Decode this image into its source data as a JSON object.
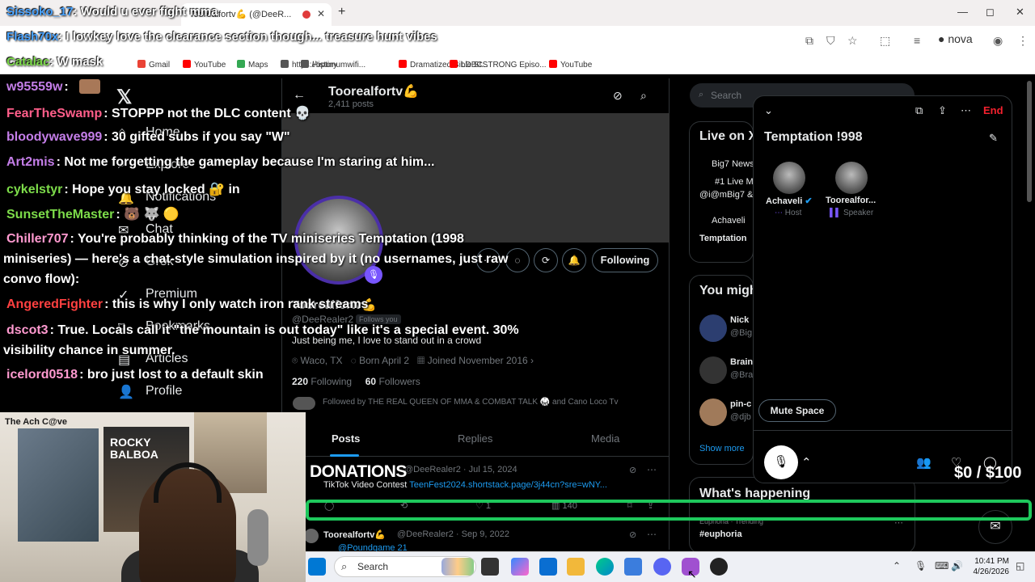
{
  "browser": {
    "tab_title": "Toorealfortv💪 (@DeeR...",
    "new_tab_icon": "+",
    "window_controls": [
      "—",
      "◻",
      "✕"
    ],
    "address_icons": [
      "screen-cast-icon",
      "shield-icon",
      "star-icon",
      "extensions-icon",
      "reading-list-icon"
    ],
    "profile_label": "nova",
    "bookmarks": [
      {
        "label": "Gmail",
        "color": "#ea4335"
      },
      {
        "label": "YouTube",
        "color": "#ff0000"
      },
      {
        "label": "Maps",
        "color": "#34a853"
      },
      {
        "label": "https://optimumwifi...",
        "color": "#555555"
      },
      {
        "label": "History",
        "color": "#555555"
      },
      {
        "label": "Dramatized Bible St...",
        "color": "#ff0000"
      },
      {
        "label": "LDBCSTRONG Episo...",
        "color": "#ff0000"
      },
      {
        "label": "YouTube",
        "color": "#ff0000"
      }
    ]
  },
  "x_nav": {
    "items": [
      "Home",
      "Explore",
      "Notifications",
      "Chat",
      "Grok",
      "Premium",
      "Bookmarks",
      "Articles",
      "Profile"
    ]
  },
  "profile": {
    "display_name": "Toorealfortv💪",
    "posts_count": "2,411 posts",
    "handle": "@DeeRealer2",
    "follows_you": "Follows you",
    "bio": "Just being me, I love to stand out in a crowd",
    "location": "Waco, TX",
    "born": "Born April 2",
    "joined": "Joined November 2016",
    "following_count": "220",
    "following_label": "Following",
    "followers_count": "60",
    "followers_label": "Followers",
    "followed_by": "Followed by THE REAL QUEEN OF MMA & COMBAT TALK 🥋 and Cano Loco Tv",
    "following_button": "Following",
    "tabs": [
      "Posts",
      "Replies",
      "Media"
    ]
  },
  "tweets": [
    {
      "author": "Toorealfortv💪",
      "handle": "@DeeRealer2",
      "date": "Jul 15, 2024",
      "text": "TikTok Video Contest",
      "link": "TeenFest2024.shortstack.page/3j44cn?sre=wNY...",
      "replies": "",
      "retweets": "",
      "likes": "1",
      "views": "140"
    },
    {
      "author": "Toorealfortv💪",
      "handle": "@DeeRealer2",
      "date": "Sep 9, 2022",
      "text": "",
      "link": "@Poundgame 21"
    }
  ],
  "right_column": {
    "search_placeholder": "Search",
    "live_title": "Live on X",
    "live_items": [
      "Big7 News",
      "#1 Live M",
      "@i@mBig7 &",
      "Achaveli",
      "Temptation"
    ],
    "you_might": "You might",
    "suggestions": [
      {
        "name": "Nick",
        "handle": "@Big"
      },
      {
        "name": "Brain",
        "handle": "@Bra"
      },
      {
        "name": "pin-c",
        "handle": "@djb"
      }
    ],
    "show_more": "Show more",
    "whats_happening": "What's happening",
    "trend_category": "Euphoria · Trending",
    "trend_name": "#euphoria"
  },
  "space": {
    "title": "Temptation !998",
    "end_label": "End",
    "host_name": "Achaveli",
    "host_role": "Host",
    "speaker_name": "Tooreal​for...",
    "speaker_role": "Speaker",
    "mute_label": "Mute Space"
  },
  "stream_overlay": {
    "top_messages": [
      {
        "user": "Sissoko_17",
        "user_color": "#4aa3ff",
        "text": ": Would u ever fight mma"
      },
      {
        "user": "Flash70x",
        "user_color": "#4aa3ff",
        "text": ": I lowkey love the clearance section though... treasure hunt vibes"
      },
      {
        "user": "Catalac",
        "user_color": "#7ddc4a",
        "text": ": W mask"
      }
    ],
    "chat": [
      {
        "user": "w95559w",
        "user_color": "#c47ee8",
        "text": ":"
      },
      {
        "user": "FearTheSwamp",
        "user_color": "#ff5e8a",
        "text": ": STOPPP not the DLC content 💀"
      },
      {
        "user": "bloodywave999",
        "user_color": "#c47ee8",
        "text": ": 30 gifted subs if you say \"W\""
      },
      {
        "user": "Art2mis",
        "user_color": "#c47ee8",
        "text": ": Not me forgetting the gameplay because I'm staring at him..."
      },
      {
        "user": "cykelstyr",
        "user_color": "#7ddc4a",
        "text": ": Hope you stay locked 🔐 in"
      },
      {
        "user": "SunsetTheMaster",
        "user_color": "#7ddc4a",
        "text": ": 🐻 🐺 🟡"
      },
      {
        "user": "Chiller707",
        "user_color": "#ff9ad0",
        "text": ": You're probably thinking of the TV miniseries Temptation (1998"
      },
      {
        "user": "AngeredFighter",
        "user_color": "#ff4040",
        "text": ": this is why I only watch iron rank streams"
      },
      {
        "user": "dscot3",
        "user_color": "#ff9ad0",
        "text": ": True. Locals call it \"the mountain is out today\" like it's a special event. 30%"
      },
      {
        "user": "icelord0518",
        "user_color": "#ff9ad0",
        "text": ": bro just lost to a default skin"
      }
    ],
    "chiller_cont1": "miniseries) — here's a chat-style simulation inspired by it (no usernames, just raw",
    "chiller_cont2": "convo flow):",
    "dscot_cont": "visibility chance in summer.",
    "donations_label": "DONATIONS",
    "donations_progress": "$0 / $100",
    "donations_raised": 0,
    "donations_goal": 100,
    "webcam_text": [
      "The Ach C@ve",
      "ROCKY",
      "BALBOA"
    ]
  },
  "taskbar": {
    "search_label": "Search",
    "time": "10:41 PM",
    "date": "4/26/2026"
  },
  "colors": {
    "x_blue": "#1d9bf0",
    "spaces_purple": "#7856ff",
    "end_red": "#f4212e",
    "progress_green": "#1ec85c"
  }
}
